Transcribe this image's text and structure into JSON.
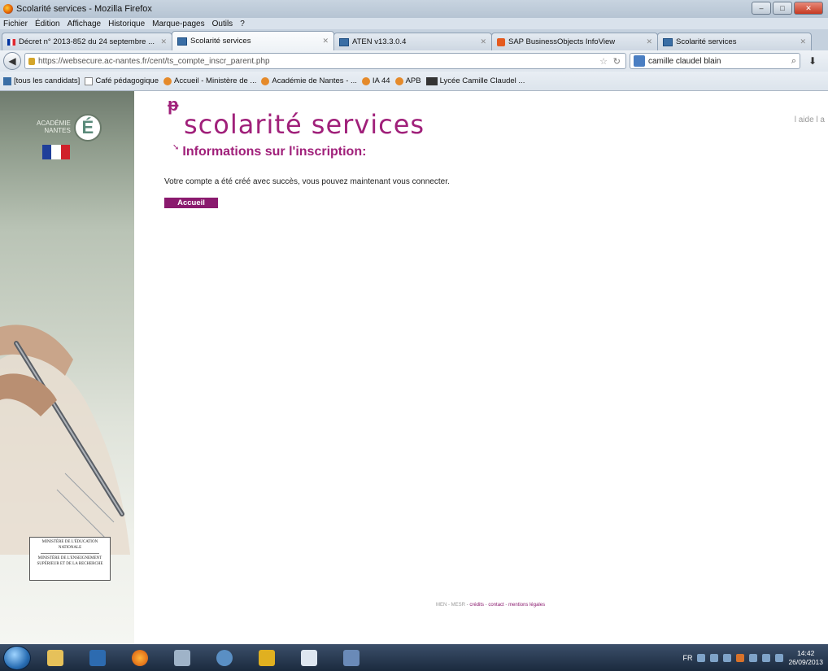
{
  "window": {
    "title": "Scolarité services - Mozilla Firefox"
  },
  "menu": [
    "Fichier",
    "Édition",
    "Affichage",
    "Historique",
    "Marque-pages",
    "Outils",
    "?"
  ],
  "tabs": [
    {
      "label": "Décret n° 2013-852 du 24 septembre ...",
      "icon": "flag-icon"
    },
    {
      "label": "Scolarité services",
      "icon": "academie-icon",
      "active": true
    },
    {
      "label": "ATEN v13.3.0.4",
      "icon": "academie-icon"
    },
    {
      "label": "SAP BusinessObjects InfoView",
      "icon": "sap-icon"
    },
    {
      "label": "Scolarité services",
      "icon": "academie-icon"
    }
  ],
  "nav": {
    "url": "https://websecure.ac-nantes.fr/cent/ts_compte_inscr_parent.php",
    "search_value": "camille claudel blain"
  },
  "bookmarks": [
    "[tous les candidats]",
    "Café pédagogique",
    "Accueil - Ministère de ...",
    "Académie de Nantes - ...",
    "IA 44",
    "APB",
    "Lycée Camille Claudel ..."
  ],
  "side": {
    "logo_text_1": "ACADÉMIE",
    "logo_text_2": "NANTES",
    "logo_letter": "É",
    "ministry_1": "MINISTÈRE DE L'ÉDUCATION NATIONALE",
    "ministry_2": "MINISTÈRE DE L'ENSEIGNEMENT SUPÉRIEUR ET DE LA RECHERCHE"
  },
  "page": {
    "brand": "scolarité services",
    "top_right": "l aide l a",
    "section_title": "Informations sur l'inscription:",
    "message": "Votre compte a été créé avec succès, vous pouvez maintenant vous connecter.",
    "button": "Accueil",
    "footer": {
      "men": "MEN - MESR",
      "credits": "crédits",
      "contact": "contact",
      "legal": "mentions légales"
    }
  },
  "taskbar": {
    "lang": "FR",
    "time": "14:42",
    "date": "26/09/2013"
  },
  "colors": {
    "brand": "#a0207a",
    "button": "#8a1a6e"
  }
}
